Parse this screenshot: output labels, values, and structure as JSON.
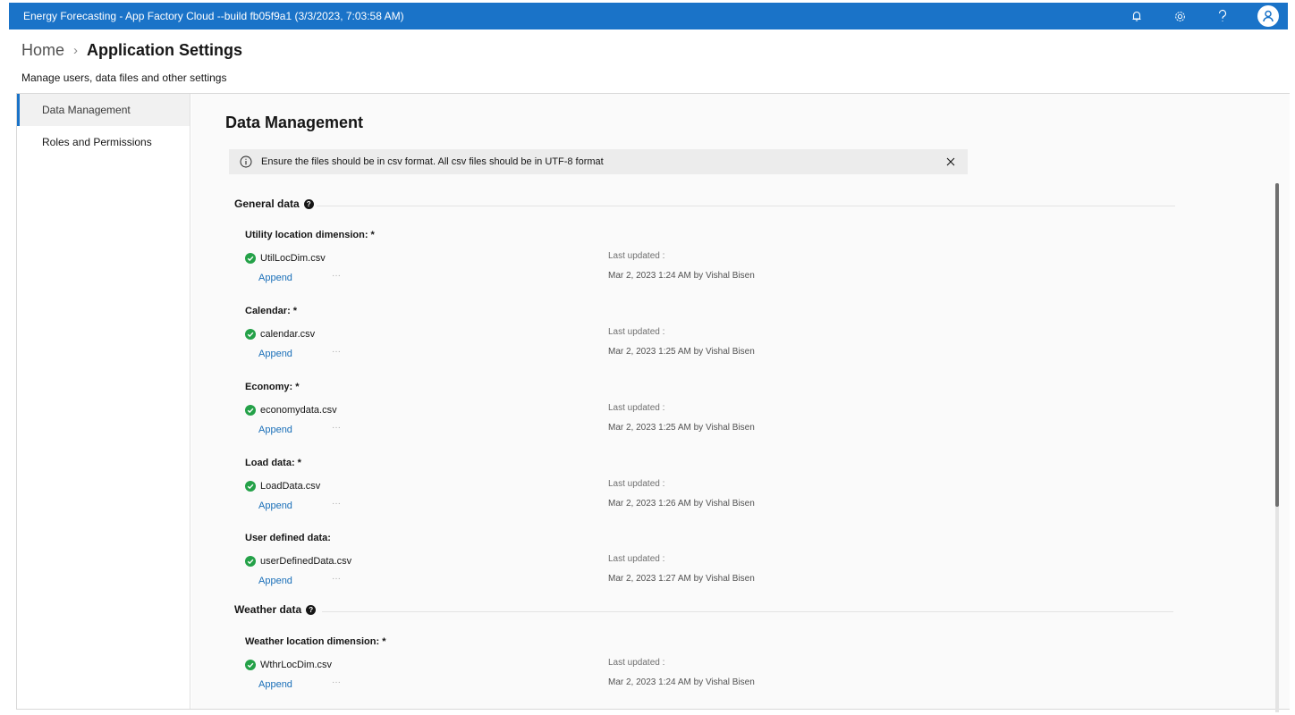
{
  "app": {
    "title": "Energy Forecasting - App Factory Cloud --build fb05f9a1 (3/3/2023, 7:03:58 AM)",
    "accent": "#1a73c8",
    "icons": [
      "bell-icon",
      "gear-icon",
      "help-icon",
      "user-avatar-icon"
    ]
  },
  "header": {
    "home": "Home",
    "separator": "›",
    "current": "Application Settings",
    "subtitle": "Manage users, data files and other settings"
  },
  "sidebar": {
    "items": [
      {
        "label": "Data Management",
        "active": true
      },
      {
        "label": "Roles and Permissions",
        "active": false
      }
    ]
  },
  "main": {
    "title": "Data Management",
    "notice": "Ensure the files should be in csv format. All csv files should be in UTF-8 format",
    "sections": [
      {
        "title": "General data",
        "items": [
          {
            "label": "Utility location dimension: *",
            "file": "UtilLocDim.csv",
            "action": "Append",
            "more": "···",
            "last_updated_label": "Last updated :",
            "last_updated": "Mar 2, 2023 1:24 AM by Vishal Bisen"
          },
          {
            "label": "Calendar: *",
            "file": "calendar.csv",
            "action": "Append",
            "more": "···",
            "last_updated_label": "Last updated :",
            "last_updated": "Mar 2, 2023 1:25 AM by Vishal Bisen"
          },
          {
            "label": "Economy: *",
            "file": "economydata.csv",
            "action": "Append",
            "more": "···",
            "last_updated_label": "Last updated :",
            "last_updated": "Mar 2, 2023 1:25 AM by Vishal Bisen"
          },
          {
            "label": "Load data: *",
            "file": "LoadData.csv",
            "action": "Append",
            "more": "···",
            "last_updated_label": "Last updated :",
            "last_updated": "Mar 2, 2023 1:26 AM by Vishal Bisen"
          },
          {
            "label": "User defined data:",
            "file": "userDefinedData.csv",
            "action": "Append",
            "more": "···",
            "last_updated_label": "Last updated :",
            "last_updated": "Mar 2, 2023 1:27 AM by Vishal Bisen"
          }
        ]
      },
      {
        "title": "Weather data",
        "items": [
          {
            "label": "Weather location dimension: *",
            "file": "WthrLocDim.csv",
            "action": "Append",
            "more": "···",
            "last_updated_label": "Last updated :",
            "last_updated": "Mar 2, 2023 1:24 AM by Vishal Bisen"
          }
        ]
      }
    ]
  }
}
